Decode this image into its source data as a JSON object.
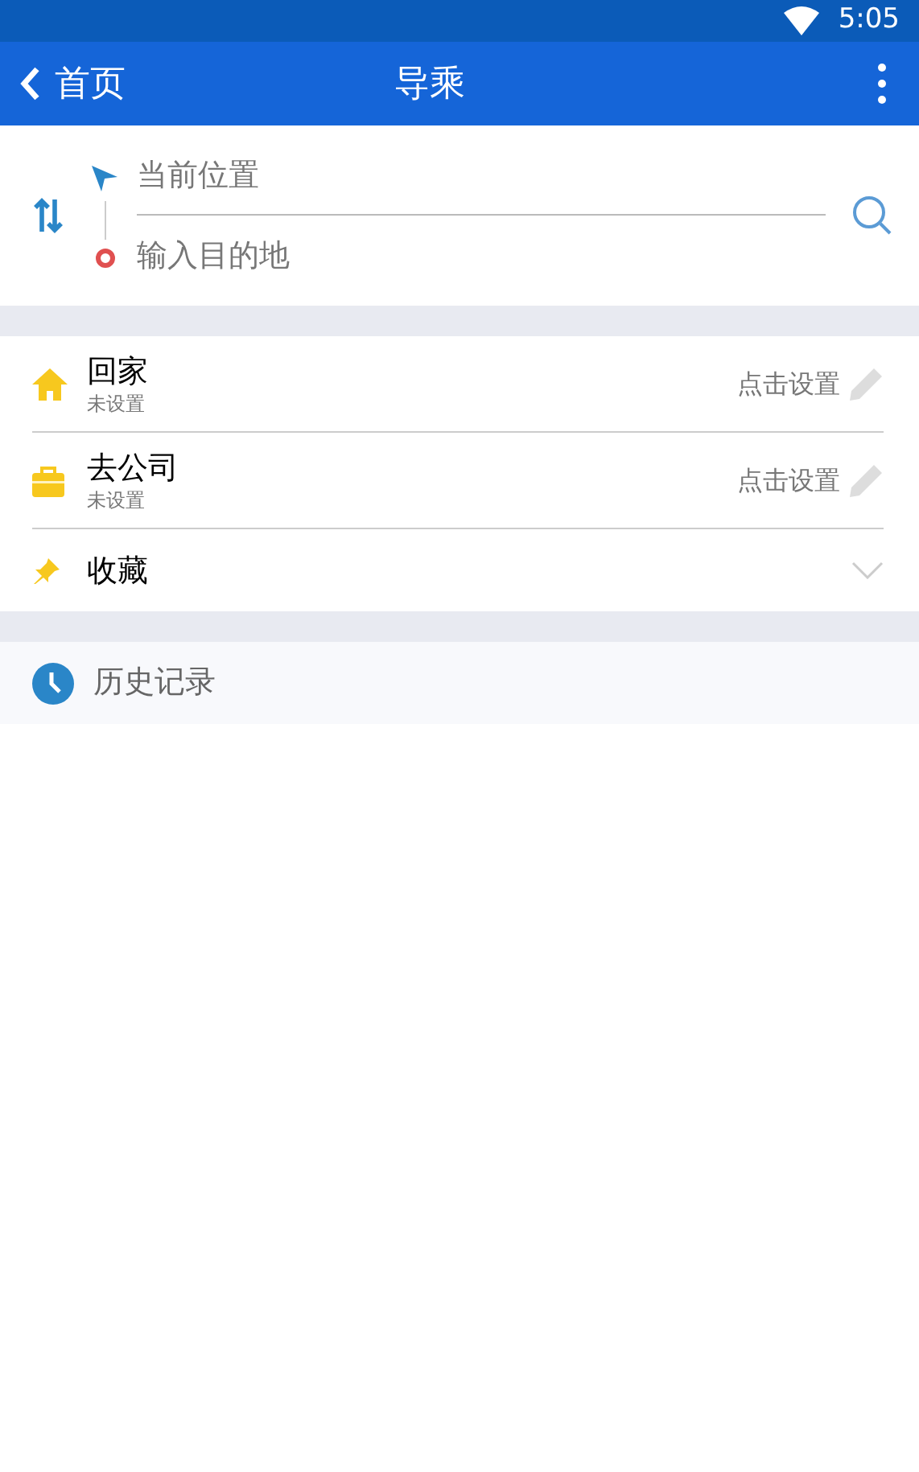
{
  "status_bar": {
    "time": "5:05"
  },
  "app_bar": {
    "back_label": "首页",
    "title": "导乘"
  },
  "route": {
    "origin_placeholder": "当前位置",
    "destination_placeholder": "输入目的地"
  },
  "places": [
    {
      "kind": "home",
      "title": "回家",
      "subtitle": "未设置",
      "action": "点击设置"
    },
    {
      "kind": "work",
      "title": "去公司",
      "subtitle": "未设置",
      "action": "点击设置"
    },
    {
      "kind": "favorites",
      "title": "收藏"
    }
  ],
  "history": {
    "title": "历史记录"
  }
}
